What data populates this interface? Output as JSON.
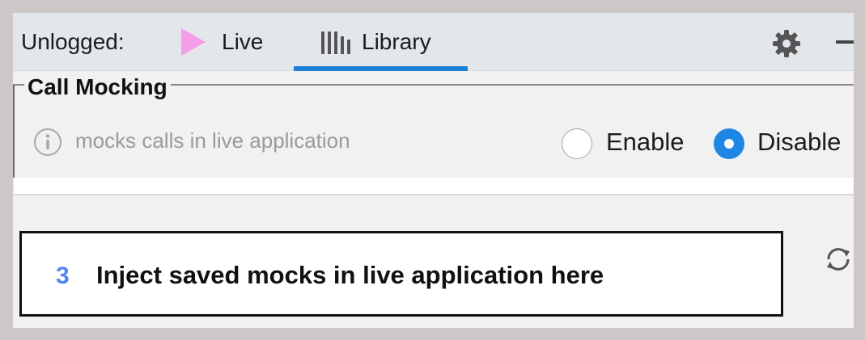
{
  "header": {
    "status_label": "Unlogged:",
    "tabs": [
      {
        "label": "Live",
        "icon": "play-icon",
        "active": false
      },
      {
        "label": "Library",
        "icon": "library-icon",
        "active": true
      }
    ]
  },
  "call_mocking": {
    "title": "Call Mocking",
    "info_text": "mocks calls in live application",
    "options": [
      {
        "label": "Enable",
        "selected": false
      },
      {
        "label": "Disable",
        "selected": true
      }
    ]
  },
  "callout": {
    "step_number": "3",
    "text": "Inject saved mocks in live application here"
  },
  "colors": {
    "accent": "#1d7fd8",
    "play_pink": "#f59ee7",
    "step_blue": "#4d86f2"
  }
}
